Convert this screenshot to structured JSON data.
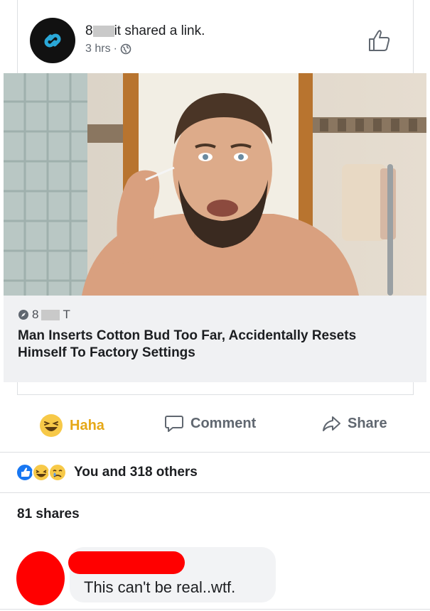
{
  "post": {
    "author_prefix": "8",
    "author_suffix": "it",
    "action_text": "shared a link.",
    "time": "3 hrs",
    "time_separator": "·"
  },
  "link": {
    "source_prefix": "8",
    "source_suffix": "T",
    "headline_line1": "Man Inserts Cotton Bud Too Far, Accidentally Resets",
    "headline_line2": "Himself To Factory Settings"
  },
  "actions": {
    "haha_label": "Haha",
    "comment_label": "Comment",
    "share_label": "Share"
  },
  "reactions": {
    "summary": "You and 318 others"
  },
  "shares": {
    "count_text": "81 shares"
  },
  "comment": {
    "text": "This can't be real..wtf."
  },
  "colors": {
    "haha_accent": "#e6a817",
    "muted_text": "#606770",
    "like_blue": "#1877f2",
    "redaction_red": "#ff0000"
  }
}
